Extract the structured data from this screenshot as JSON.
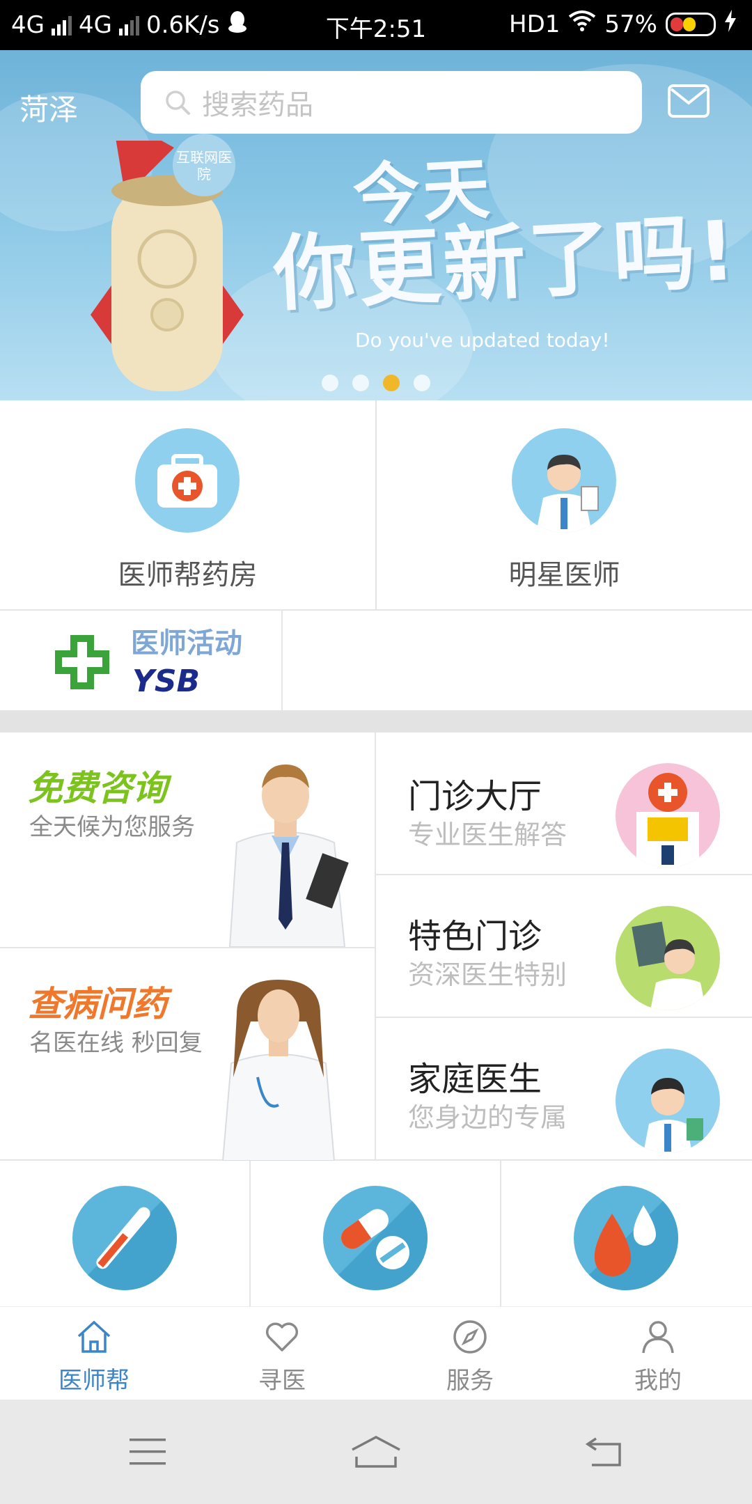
{
  "status_bar": {
    "net1": "4G",
    "net2": "4G",
    "speed": "0.6K/s",
    "time": "下午2:51",
    "hd": "HD1",
    "battery": "57%"
  },
  "header": {
    "city": "菏泽",
    "search_placeholder": "搜索药品"
  },
  "banner": {
    "headline_line1": "今天",
    "headline_line2": "你更新了吗!",
    "badge": "互联网医院",
    "subtitle": "Do you've updated today!",
    "active_index": 2,
    "dot_count": 4
  },
  "quick_entries": [
    {
      "label": "医师帮药房",
      "icon": "medical-kit-icon"
    },
    {
      "label": "明星医师",
      "icon": "doctor-icon"
    }
  ],
  "activity": {
    "logo_text": "医师活动",
    "logo_letters": "YSB"
  },
  "services_left": [
    {
      "title": "免费咨询",
      "subtitle": "全天候为您服务",
      "color": "#7cc31e"
    },
    {
      "title": "查病问药",
      "subtitle": "名医在线 秒回复",
      "color": "#f0782c"
    }
  ],
  "services_right": [
    {
      "title": "门诊大厅",
      "subtitle": "专业医生解答",
      "icon": "hospital-icon"
    },
    {
      "title": "特色门诊",
      "subtitle": "资深医生特别",
      "icon": "xray-doctor-icon"
    },
    {
      "title": "家庭医生",
      "subtitle": "您身边的专属",
      "icon": "family-doctor-icon"
    }
  ],
  "tools": [
    {
      "icon": "thermometer-icon"
    },
    {
      "icon": "pill-icon"
    },
    {
      "icon": "blood-drop-icon"
    }
  ],
  "tabs": [
    {
      "label": "医师帮",
      "icon": "home-icon",
      "active": true
    },
    {
      "label": "寻医",
      "icon": "heart-icon",
      "active": false
    },
    {
      "label": "服务",
      "icon": "compass-icon",
      "active": false
    },
    {
      "label": "我的",
      "icon": "user-icon",
      "active": false
    }
  ],
  "colors": {
    "accent": "#3b86c8",
    "banner_blue": "#8ac7e6",
    "icon_circle": "#8fd0ef"
  }
}
